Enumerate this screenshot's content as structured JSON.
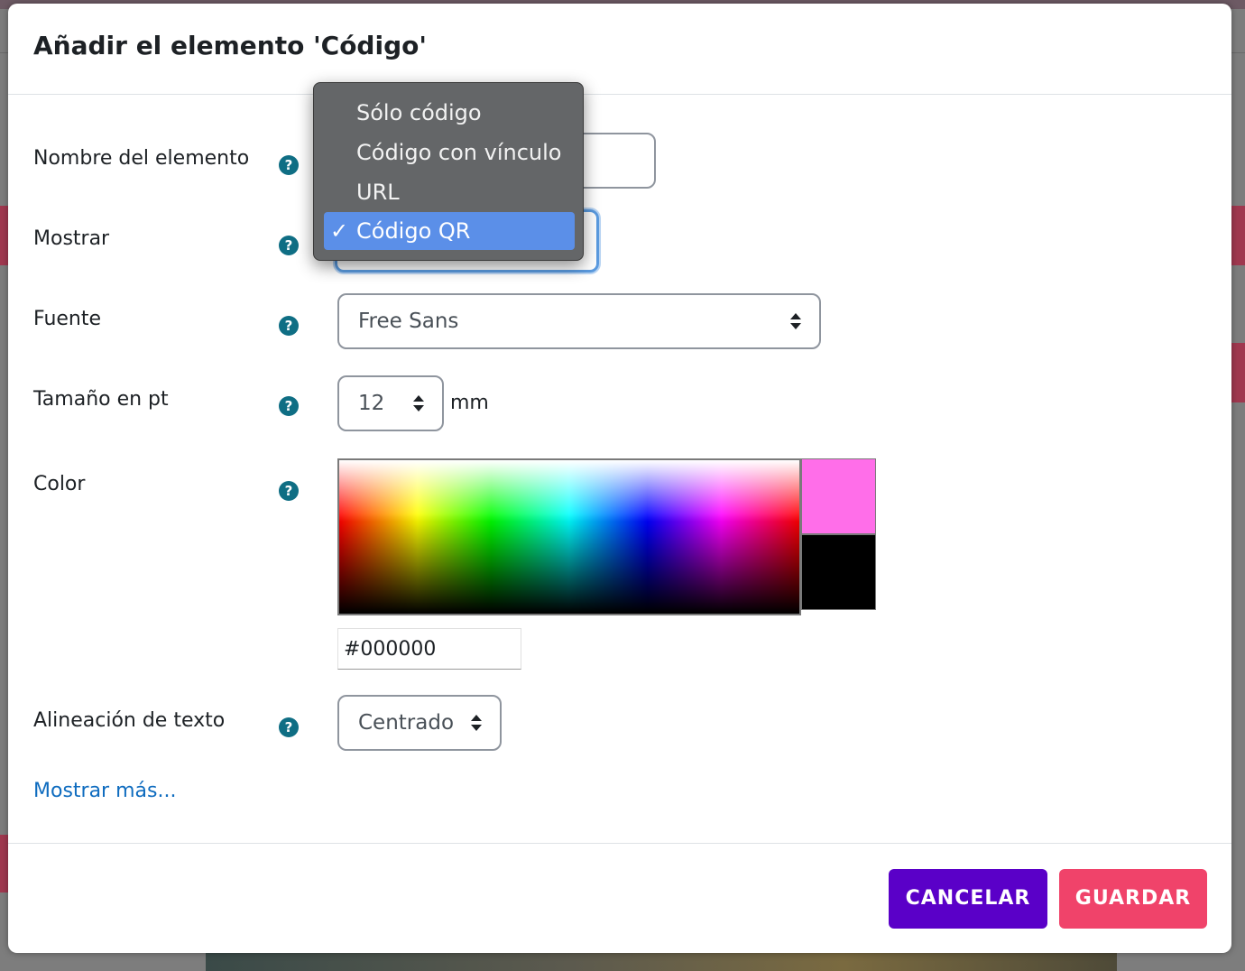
{
  "modal": {
    "title": "Añadir el elemento 'Código'"
  },
  "form": {
    "name_label": "Nombre del elemento",
    "show_label": "Mostrar",
    "font_label": "Fuente",
    "font_value": "Free Sans",
    "size_label": "Tamaño en pt",
    "size_value": "12",
    "size_unit": "mm",
    "color_label": "Color",
    "color_hex": "#000000",
    "align_label": "Alineación de texto",
    "align_value": "Centrado",
    "help_glyph": "?",
    "more_link": "Mostrar más..."
  },
  "dropdown": {
    "options": [
      "Sólo código",
      "Código con vínculo",
      "URL",
      "Código QR"
    ],
    "selected_index": 3,
    "check_glyph": "✓"
  },
  "footer": {
    "cancel_label": "CANCELAR",
    "save_label": "GUARDAR"
  },
  "colors": {
    "accent_blue": "#5b8fe8",
    "cancel_bg": "#5a00c8",
    "save_bg": "#f0436a",
    "help_icon": "#0f6e84",
    "swatch_new": "#ff6ee9",
    "swatch_old": "#000000"
  }
}
